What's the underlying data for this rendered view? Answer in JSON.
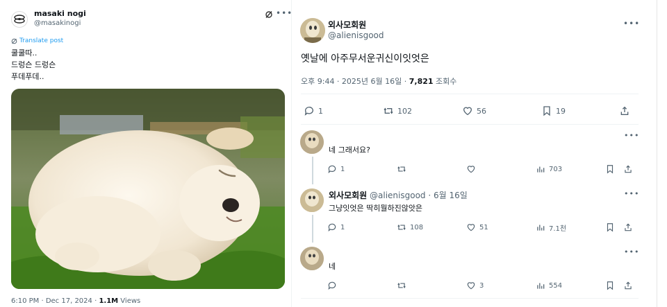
{
  "left_tweet": {
    "author_name": "masaki nogi",
    "author_handle": "@masakinogi",
    "translate_label": "Translate post",
    "text_lines": [
      "쿨쿨따..",
      "드렁슨 드렁슨",
      "푸데푸데.."
    ],
    "meta_time": "6:10 PM · Dec 17, 2024 · ",
    "meta_views_count": "1.1M",
    "meta_views_label": " Views",
    "icons": [
      "grok-icon",
      "more-icon",
      "translate-icon"
    ]
  },
  "right_tweet": {
    "author_name": "외사모회원",
    "author_handle": "@alienisgood",
    "text": "옛날에 아주무서운귀신이잇엇은",
    "meta_time": "오후 9:44 · 2025년 6월 16일 · ",
    "meta_views_count": "7,821",
    "meta_views_label": " 조회수",
    "actions": {
      "reply": "1",
      "retweet": "102",
      "like": "56",
      "bookmark": "19"
    }
  },
  "replies": [
    {
      "text": "네 그래서요?",
      "actions": {
        "reply": "1",
        "retweet": "",
        "like": "",
        "views": "703"
      }
    },
    {
      "author_name": "외사모회원",
      "author_handle": "@alienisgood",
      "date": " · 6월 16일",
      "text": "그냥잇엇은 딱히뭘하진않앗은",
      "actions": {
        "reply": "1",
        "retweet": "108",
        "like": "51",
        "views": "7.1천"
      }
    },
    {
      "text": "네",
      "actions": {
        "reply": "",
        "retweet": "",
        "like": "3",
        "views": "554"
      }
    }
  ],
  "colors": {
    "accent": "#1d9bf0",
    "text": "#0f1419",
    "secondary": "#536471",
    "border": "#eff3f4"
  }
}
